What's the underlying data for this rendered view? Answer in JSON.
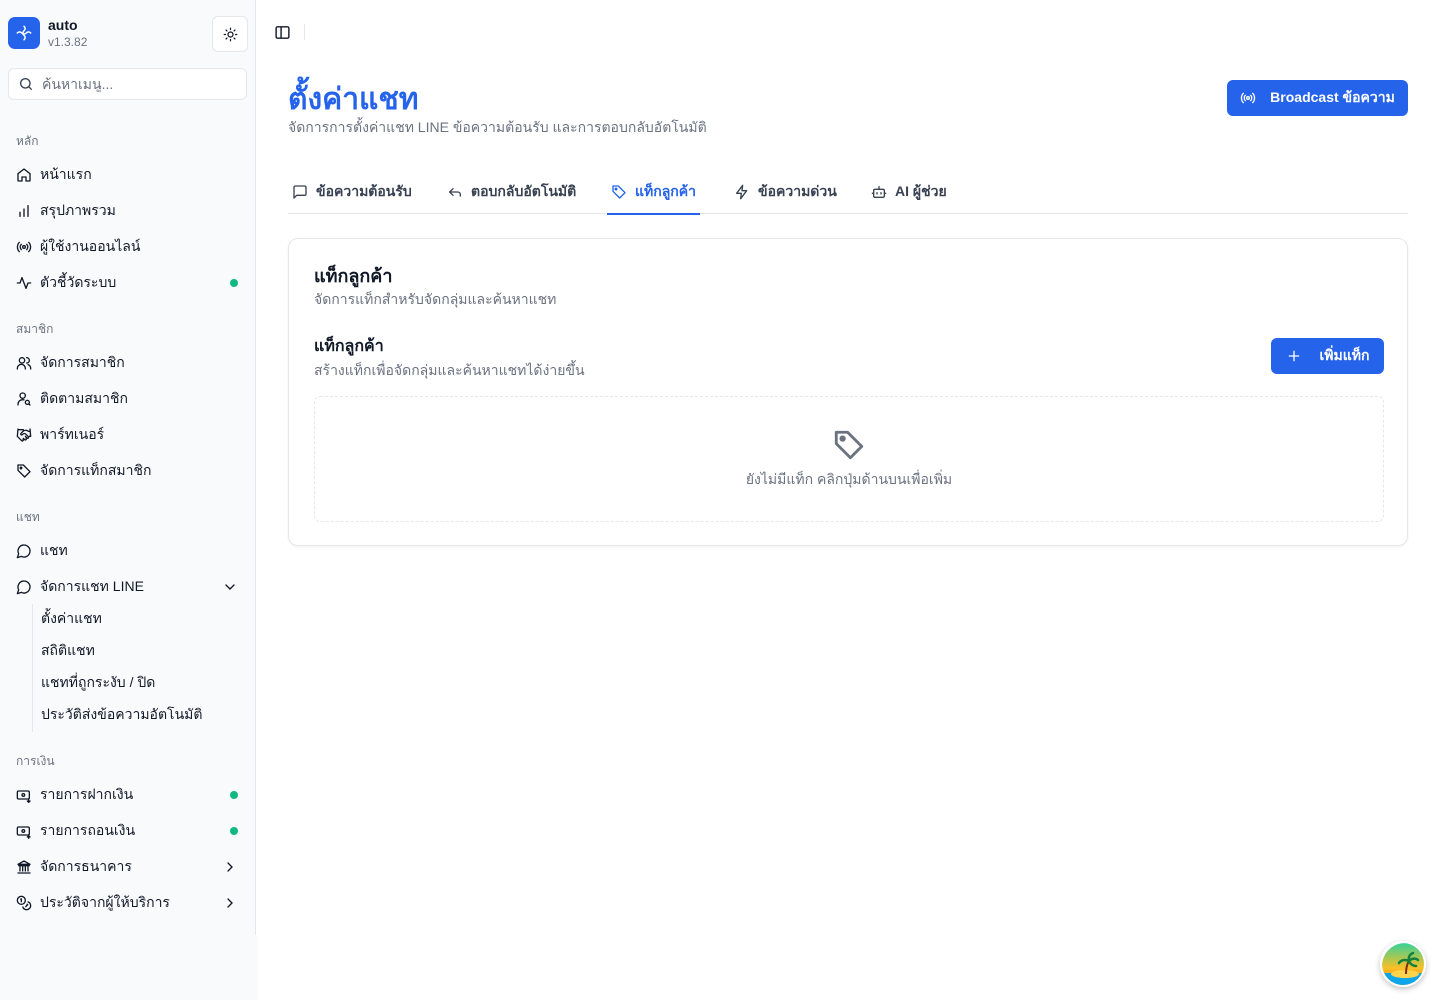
{
  "brand": {
    "name": "auto",
    "version": "v1.3.82"
  },
  "search": {
    "placeholder": "ค้นหาเมนู..."
  },
  "sidebar": {
    "sections": [
      {
        "label": "หลัก",
        "items": [
          {
            "label": "หน้าแรก",
            "icon": "home-icon"
          },
          {
            "label": "สรุปภาพรวม",
            "icon": "bar-chart-icon"
          },
          {
            "label": "ผู้ใช้งานออนไลน์",
            "icon": "radio-icon"
          },
          {
            "label": "ตัวชี้วัดระบบ",
            "icon": "activity-icon",
            "status_dot": true
          }
        ]
      },
      {
        "label": "สมาชิก",
        "items": [
          {
            "label": "จัดการสมาชิก",
            "icon": "users-icon"
          },
          {
            "label": "ติดตามสมาชิก",
            "icon": "user-search-icon"
          },
          {
            "label": "พาร์ทเนอร์",
            "icon": "handshake-icon"
          },
          {
            "label": "จัดการแท็กสมาชิก",
            "icon": "tag-icon"
          }
        ]
      },
      {
        "label": "แชท",
        "items": [
          {
            "label": "แชท",
            "icon": "message-circle-icon"
          },
          {
            "label": "จัดการแชท LINE",
            "icon": "message-circle-icon",
            "expanded": true,
            "children": [
              "ตั้งค่าแชท",
              "สถิติแชท",
              "แชทที่ถูกระงับ / ปิด",
              "ประวัติส่งข้อความอัตโนมัติ"
            ]
          }
        ]
      },
      {
        "label": "การเงิน",
        "items": [
          {
            "label": "รายการฝากเงิน",
            "icon": "deposit-icon",
            "status_dot": true
          },
          {
            "label": "รายการถอนเงิน",
            "icon": "withdraw-icon",
            "status_dot": true
          },
          {
            "label": "จัดการธนาคาร",
            "icon": "bank-icon",
            "has_children": true
          },
          {
            "label": "ประวัติจากผู้ให้บริการ",
            "icon": "coins-icon",
            "has_children": true
          }
        ]
      }
    ],
    "status_color": "#10b981"
  },
  "page": {
    "title": "ตั้งค่าแชท",
    "subtitle": "จัดการการตั้งค่าแชท LINE ข้อความต้อนรับ และการตอบกลับอัตโนมัติ",
    "broadcast_label": "Broadcast ข้อความ"
  },
  "tabs": [
    {
      "label": "ข้อความต้อนรับ",
      "icon": "message-square-icon"
    },
    {
      "label": "ตอบกลับอัตโนมัติ",
      "icon": "reply-icon"
    },
    {
      "label": "แท็กลูกค้า",
      "icon": "tag-icon",
      "active": true
    },
    {
      "label": "ข้อความด่วน",
      "icon": "zap-icon"
    },
    {
      "label": "AI ผู้ช่วย",
      "icon": "bot-icon"
    }
  ],
  "card": {
    "title": "แท็กลูกค้า",
    "subtitle": "จัดการแท็กสำหรับจัดกลุ่มและค้นหาแชท",
    "section_title": "แท็กลูกค้า",
    "section_subtitle": "สร้างแท็กเพื่อจัดกลุ่มและค้นหาแชทได้ง่ายขึ้น",
    "add_label": "เพิ่มแท็ก",
    "empty_text": "ยังไม่มีแท็ก คลิกปุ่มด้านบนเพื่อเพิ่ม"
  },
  "colors": {
    "accent": "#2563eb",
    "muted": "#6b7280",
    "border": "#e5e7eb"
  }
}
